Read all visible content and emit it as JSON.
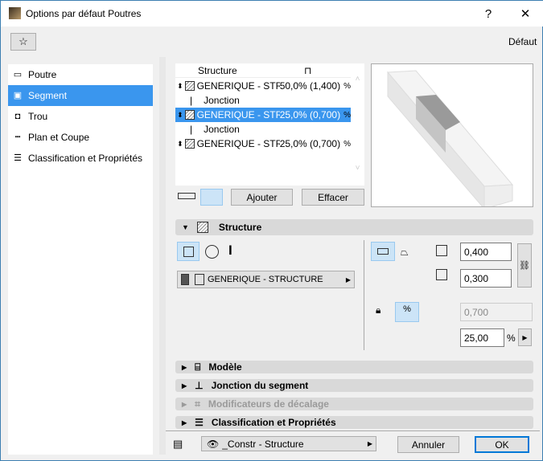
{
  "window": {
    "title": "Options par défaut Poutres",
    "help": "?",
    "close": "✕",
    "preset": "Défaut"
  },
  "sidebar": {
    "items": [
      {
        "label": "Poutre",
        "icon": "beam-icon"
      },
      {
        "label": "Segment",
        "icon": "segment-icon"
      },
      {
        "label": "Trou",
        "icon": "hole-icon"
      },
      {
        "label": "Plan et Coupe",
        "icon": "plan-section-icon"
      },
      {
        "label": "Classification et Propriétés",
        "icon": "classification-icon"
      }
    ],
    "selected": 1
  },
  "segments": {
    "header": "Structure",
    "rows": [
      {
        "type": "segment",
        "name": "GENERIQUE - STR...",
        "value": "50,0% (1,400)"
      },
      {
        "type": "junction",
        "name": "Jonction"
      },
      {
        "type": "segment",
        "name": "GENERIQUE - STR...",
        "value": "25,0% (0,700)",
        "selected": true
      },
      {
        "type": "junction",
        "name": "Jonction"
      },
      {
        "type": "segment",
        "name": "GENERIQUE - STR...",
        "value": "25,0% (0,700)"
      }
    ],
    "add": "Ajouter",
    "delete": "Effacer"
  },
  "structure": {
    "title": "Structure",
    "material": "GENERIQUE - STRUCTURE",
    "height": "0,400",
    "width": "0,300",
    "length": "0,700",
    "percent": "25,00",
    "percent_unit": "%"
  },
  "sections": [
    {
      "label": "Modèle",
      "disabled": false
    },
    {
      "label": "Jonction du segment",
      "disabled": false
    },
    {
      "label": "Modificateurs de décalage",
      "disabled": true
    },
    {
      "label": "Classification et Propriétés",
      "disabled": false
    }
  ],
  "footer": {
    "layer": "_Constr - Structure",
    "cancel": "Annuler",
    "ok": "OK"
  }
}
